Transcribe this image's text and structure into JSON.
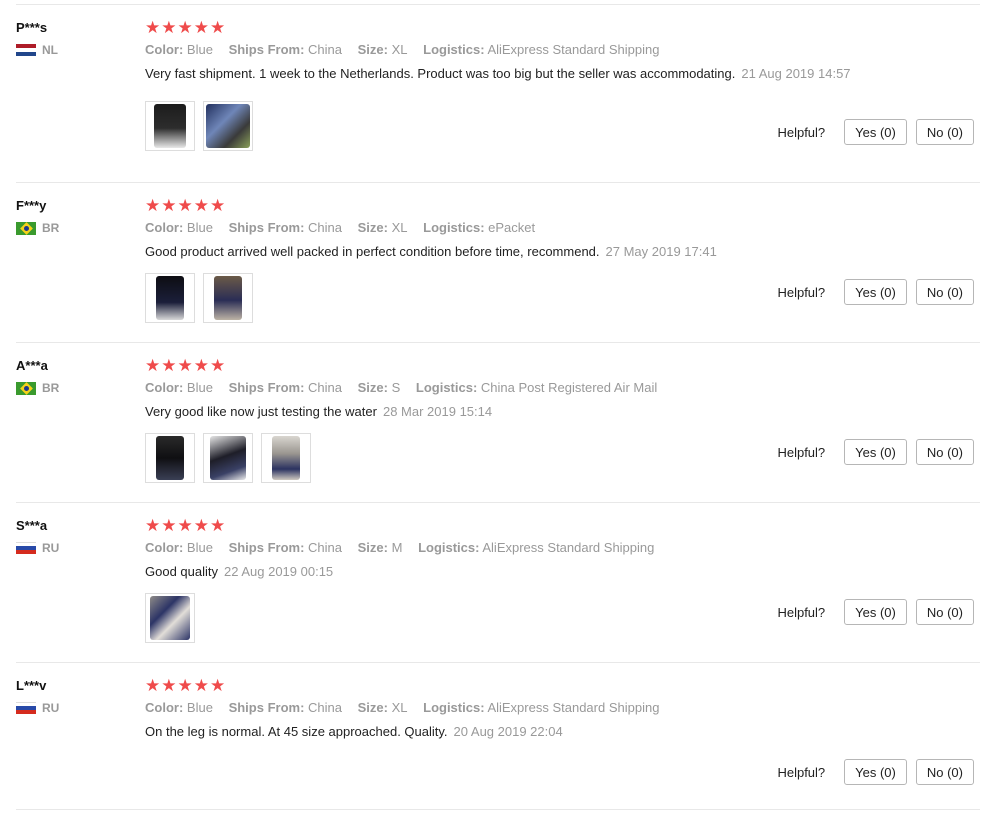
{
  "labels": {
    "color": "Color:",
    "ships_from": "Ships From:",
    "size": "Size:",
    "logistics": "Logistics:",
    "helpful": "Helpful?",
    "yes": "Yes (0)",
    "no": "No (0)"
  },
  "colors": {
    "star": "#ef4b4b",
    "muted_text": "#999999",
    "divider": "#e8e8e8"
  },
  "reviews": [
    {
      "user": "P***s",
      "country": "NL",
      "stars": 5,
      "color": "Blue",
      "ships_from": "China",
      "size": "XL",
      "logistics": "AliExpress Standard Shipping",
      "text": "Very fast shipment. 1 week to the Netherlands. Product was too big but the seller was accommodating.",
      "date": "21 Aug 2019 14:57",
      "photos": 2
    },
    {
      "user": "F***y",
      "country": "BR",
      "stars": 5,
      "color": "Blue",
      "ships_from": "China",
      "size": "XL",
      "logistics": "ePacket",
      "text": "Good product arrived well packed in perfect condition before time, recommend.",
      "date": "27 May 2019 17:41",
      "photos": 2
    },
    {
      "user": "A***a",
      "country": "BR",
      "stars": 5,
      "color": "Blue",
      "ships_from": "China",
      "size": "S",
      "logistics": "China Post Registered Air Mail",
      "text": "Very good like now just testing the water",
      "date": "28 Mar 2019 15:14",
      "photos": 3
    },
    {
      "user": "S***a",
      "country": "RU",
      "stars": 5,
      "color": "Blue",
      "ships_from": "China",
      "size": "M",
      "logistics": "AliExpress Standard Shipping",
      "text": "Good quality",
      "date": "22 Aug 2019 00:15",
      "photos": 1
    },
    {
      "user": "L***v",
      "country": "RU",
      "stars": 5,
      "color": "Blue",
      "ships_from": "China",
      "size": "XL",
      "logistics": "AliExpress Standard Shipping",
      "text": "On the leg is normal. At 45 size approached. Quality.",
      "date": "20 Aug 2019 22:04",
      "photos": 0
    }
  ]
}
